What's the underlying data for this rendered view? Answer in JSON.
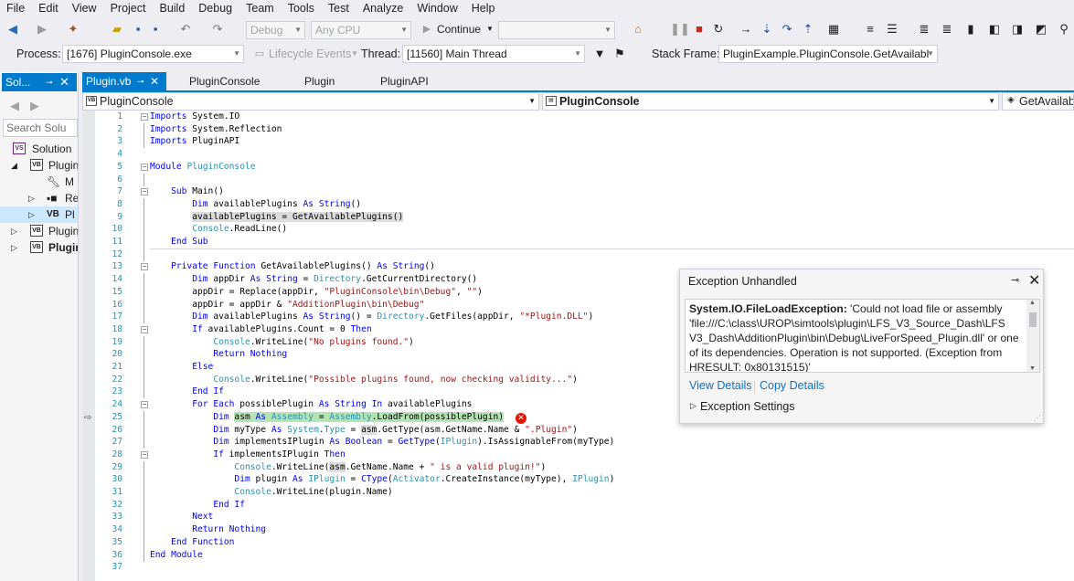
{
  "menu": [
    "File",
    "Edit",
    "View",
    "Project",
    "Build",
    "Debug",
    "Team",
    "Tools",
    "Test",
    "Analyze",
    "Window",
    "Help"
  ],
  "toolbar": {
    "config_value": "Debug",
    "platform_value": "Any CPU",
    "continue_label": "Continue"
  },
  "toolbar2": {
    "process_label": "Process:",
    "process_value": "[1676] PluginConsole.exe",
    "lifecycle_label": "Lifecycle Events",
    "thread_label": "Thread:",
    "thread_value": "[11560] Main Thread",
    "stackframe_label": "Stack Frame:",
    "stackframe_value": "PluginExample.PluginConsole.GetAvailabl"
  },
  "solution_explorer": {
    "tab_label": "Sol...",
    "search_placeholder": "Search Solu",
    "items": [
      {
        "label": "Solution",
        "icon": "VS"
      },
      {
        "label": "Plugin",
        "icon": "VB"
      },
      {
        "label": "M",
        "icon": "wrench"
      },
      {
        "label": "Re",
        "icon": "references"
      },
      {
        "label": "Pl",
        "icon": "VB"
      },
      {
        "label": "Plugin",
        "icon": "VB"
      },
      {
        "label": "Plugin",
        "icon": "VB"
      }
    ]
  },
  "editor_tabs": [
    {
      "label": "Plugin.vb",
      "active": true
    },
    {
      "label": "PluginConsole",
      "active": false
    },
    {
      "label": "Plugin",
      "active": false
    },
    {
      "label": "PluginAPI",
      "active": false
    }
  ],
  "navbar": {
    "project": "PluginConsole",
    "type": "PluginConsole",
    "member": "GetAvailab"
  },
  "code": {
    "line_numbers": [
      "1",
      "2",
      "3",
      "4",
      "5",
      "6",
      "7",
      "8",
      "9",
      "10",
      "11",
      "12",
      "13",
      "14",
      "15",
      "16",
      "17",
      "18",
      "19",
      "20",
      "21",
      "22",
      "23",
      "24",
      "25",
      "26",
      "27",
      "28",
      "29",
      "30",
      "31",
      "32",
      "33",
      "34",
      "35",
      "36",
      "37"
    ]
  },
  "exception": {
    "title": "Exception Unhandled",
    "type": "System.IO.FileLoadException:",
    "message": "'Could not load file or assembly 'file:///C:\\class\\UROP\\simtools\\plugin\\LFS_V3_Source_Dash\\LFS V3_Dash\\AdditionPlugin\\bin\\Debug\\LiveForSpeed_Plugin.dll' or one of its dependencies. Operation is not supported. (Exception from HRESULT: 0x80131515)'",
    "view_details": "View Details",
    "copy_details": "Copy Details",
    "settings": "Exception Settings"
  }
}
